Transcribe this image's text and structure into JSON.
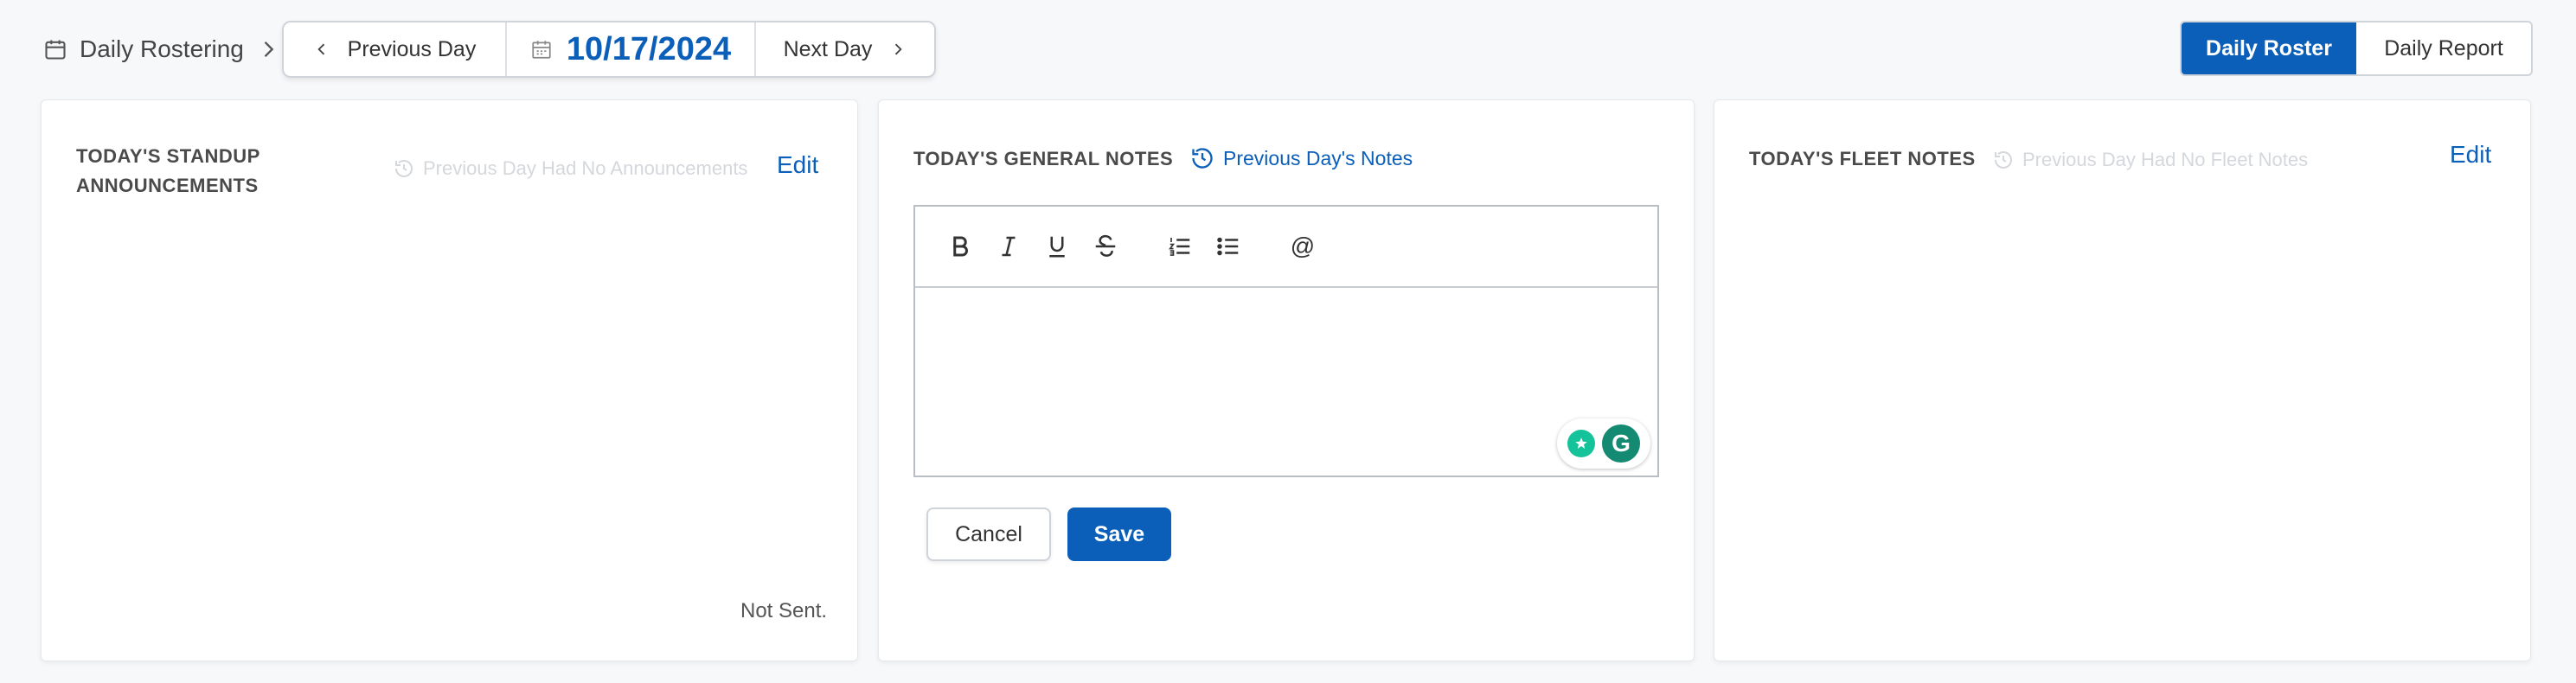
{
  "breadcrumb": {
    "label": "Daily Rostering",
    "icon": "calendar-icon"
  },
  "day_nav": {
    "previous_label": "Previous Day",
    "date": "10/17/2024",
    "next_label": "Next Day"
  },
  "view_toggle": {
    "active": "Daily Roster",
    "inactive": "Daily Report"
  },
  "colors": {
    "accent": "#0c5fb8",
    "muted": "#d4d7db",
    "grammarly_light": "#15c39a",
    "grammarly_dark": "#158a73"
  },
  "panels": {
    "standup": {
      "title_line1": "TODAY'S STANDUP",
      "title_line2": "ANNOUNCEMENTS",
      "history_text": "Previous Day Had No Announcements",
      "edit_label": "Edit",
      "status": "Not Sent."
    },
    "general": {
      "title": "TODAY'S GENERAL NOTES",
      "previous_link": "Previous Day's Notes",
      "toolbar": [
        "bold",
        "italic",
        "underline",
        "strikethrough",
        "ordered-list",
        "bullet-list",
        "mention"
      ],
      "mention_symbol": "@",
      "grammarly_letter": "G",
      "cancel_label": "Cancel",
      "save_label": "Save"
    },
    "fleet": {
      "title": "TODAY'S FLEET NOTES",
      "history_text": "Previous Day Had No Fleet Notes",
      "edit_label": "Edit"
    }
  }
}
